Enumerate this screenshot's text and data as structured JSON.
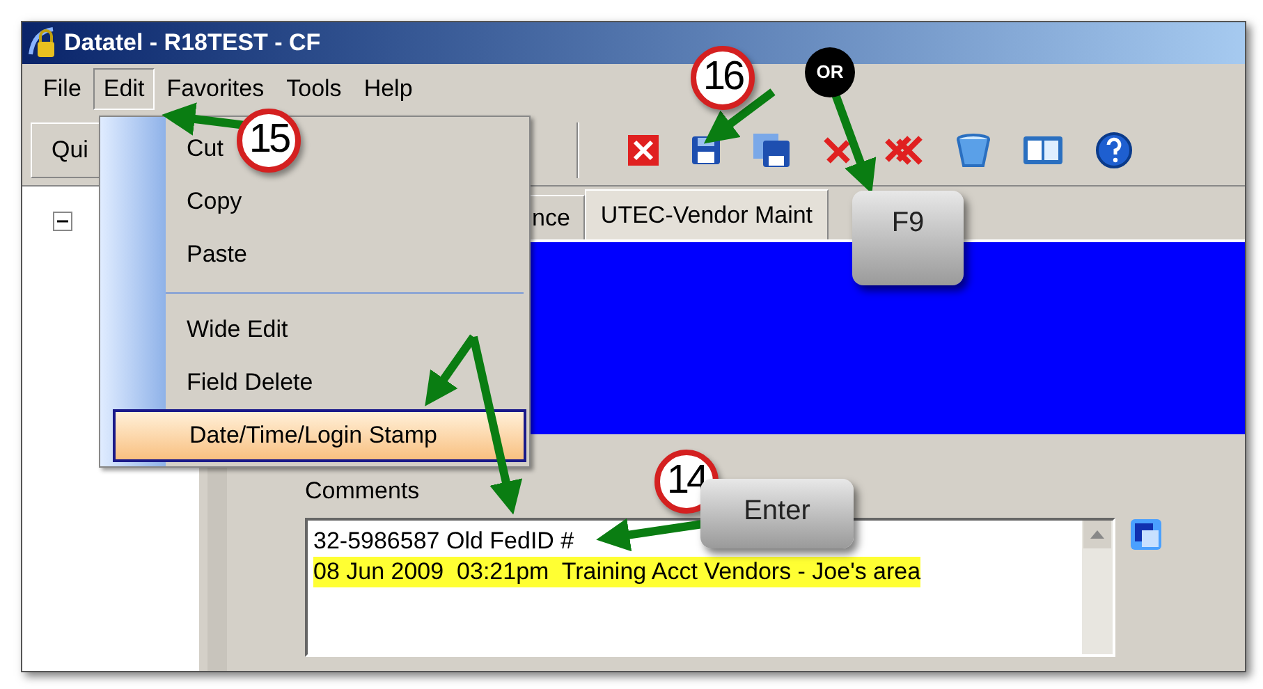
{
  "window": {
    "title": "Datatel - R18TEST - CF"
  },
  "menu_bar": [
    {
      "label": "File",
      "selected": false
    },
    {
      "label": "Edit",
      "selected": true
    },
    {
      "label": "Favorites",
      "selected": false
    },
    {
      "label": "Tools",
      "selected": false
    },
    {
      "label": "Help",
      "selected": false
    }
  ],
  "edit_menu": [
    {
      "kind": "item",
      "label": "Cut",
      "selected": false
    },
    {
      "kind": "item",
      "label": "Copy",
      "selected": false
    },
    {
      "kind": "item",
      "label": "Paste",
      "selected": false
    },
    {
      "kind": "separator"
    },
    {
      "kind": "item",
      "label": "Wide Edit",
      "selected": false
    },
    {
      "kind": "item",
      "label": "Field Delete",
      "selected": false
    },
    {
      "kind": "item",
      "label": "Date/Time/Login Stamp",
      "selected": true
    }
  ],
  "toolbar": {
    "quick_button": "Qui"
  },
  "tabs": [
    {
      "label": "nce",
      "selected": false
    },
    {
      "label": "UTEC-Vendor Maint",
      "selected": true
    }
  ],
  "form": {
    "comments_label": "Comments",
    "comments": [
      {
        "text": "32-5986587 Old FedID #",
        "highlighted": false
      },
      {
        "text": "08 Jun 2009  03:21pm  Training Acct Vendors - Joe's area",
        "highlighted": true
      }
    ]
  },
  "annotations": {
    "callouts": [
      {
        "kind": "step",
        "label": "15"
      },
      {
        "kind": "step",
        "label": "16"
      },
      {
        "kind": "or",
        "label": "OR"
      },
      {
        "kind": "step",
        "label": "14"
      }
    ],
    "keys": [
      "F9",
      "Enter"
    ]
  }
}
